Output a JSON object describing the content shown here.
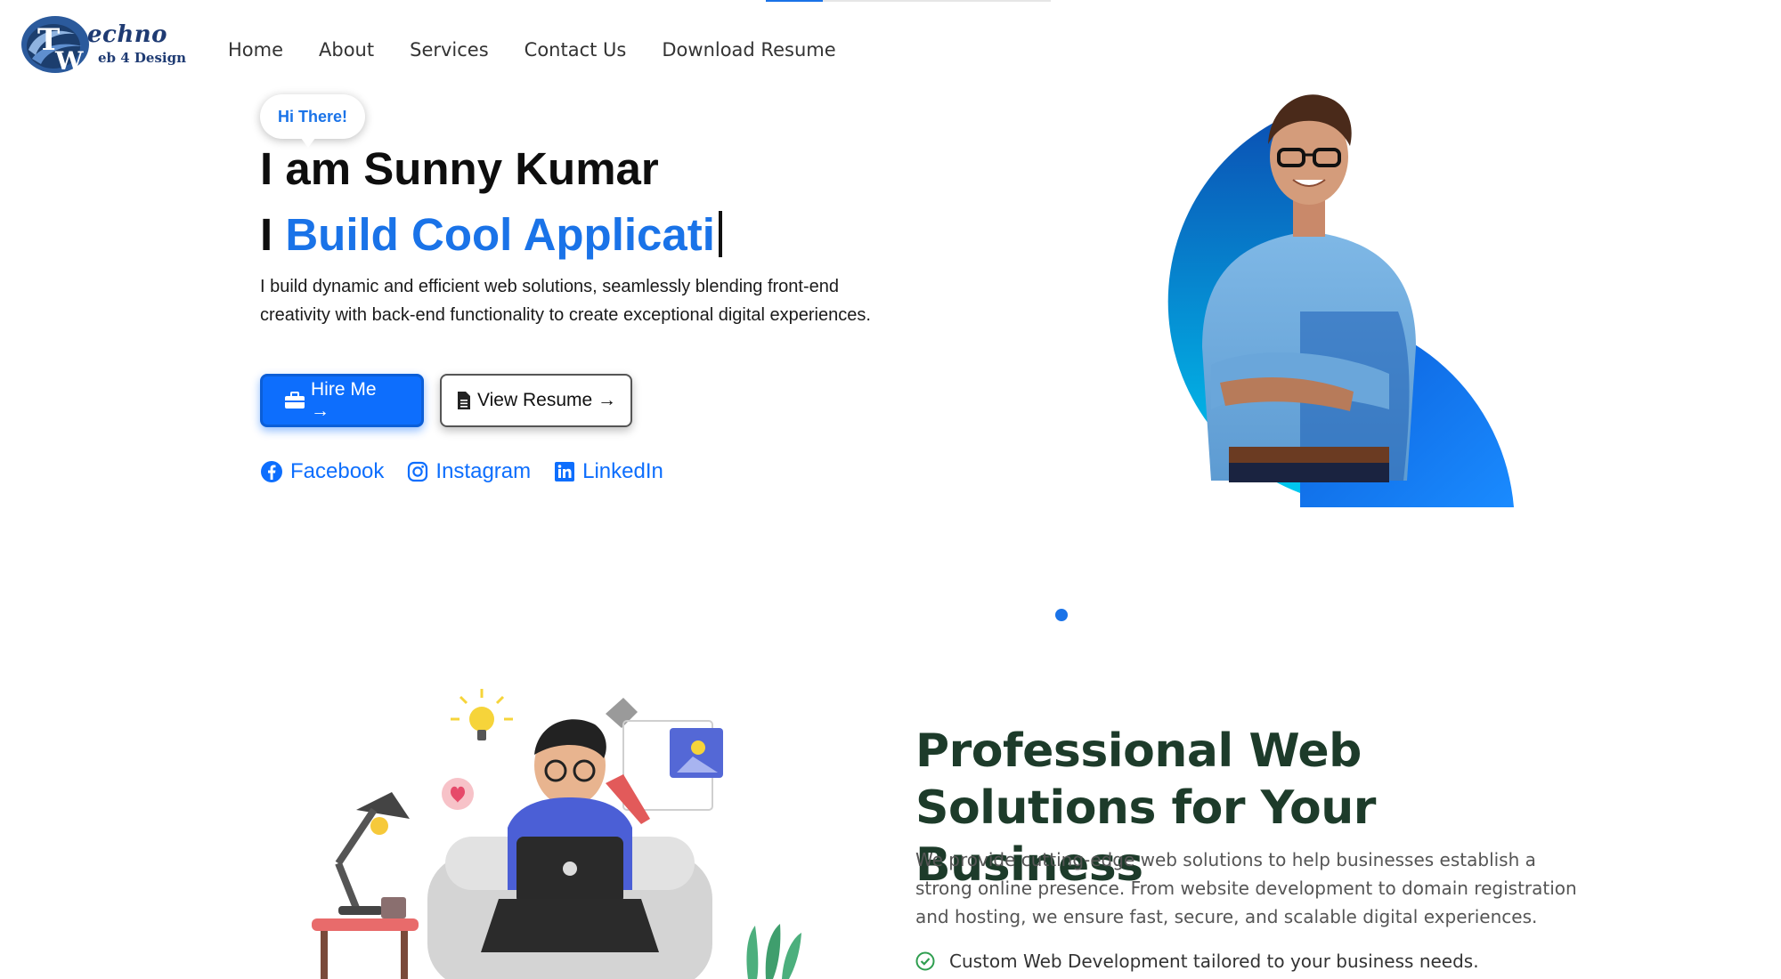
{
  "header": {
    "logo": {
      "word1": "echno",
      "word2": "eb 4 Design",
      "letters": "TW"
    },
    "nav": [
      "Home",
      "About",
      "Services",
      "Contact Us",
      "Download Resume"
    ]
  },
  "hero": {
    "badge": "Hi There!",
    "name_line": "I am Sunny Kumar",
    "build_prefix": "I ",
    "build_highlight": "Build Cool Applicati",
    "description": "I build dynamic and efficient web solutions, seamlessly blending front-end creativity with back-end functionality to create exceptional digital experiences.",
    "hire_label": "Hire Me →",
    "resume_label": "View Resume →",
    "social": [
      {
        "label": "Facebook",
        "icon": "facebook-icon"
      },
      {
        "label": "Instagram",
        "icon": "instagram-icon"
      },
      {
        "label": "LinkedIn",
        "icon": "linkedin-icon"
      }
    ]
  },
  "colors": {
    "accent": "#1a73e8",
    "button": "#0d6efd",
    "heading_dark": "#1d3b2a"
  },
  "section2": {
    "title": "Professional Web Solutions for Your Business",
    "description": "We provide cutting-edge web solutions to help businesses establish a strong online presence. From website development to domain registration and hosting, we ensure fast, secure, and scalable digital experiences.",
    "features": [
      "Custom Web Development tailored to your business needs."
    ]
  }
}
